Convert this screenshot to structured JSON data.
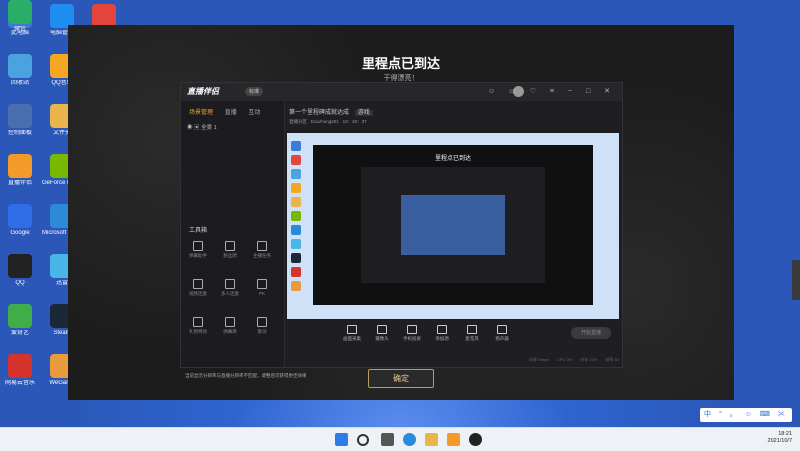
{
  "desktop": {
    "icons": [
      {
        "label": "此电脑",
        "color": "#3a7bd5"
      },
      {
        "label": "电脑管家",
        "color": "#1f8ef1"
      },
      {
        "label": "WPS Office",
        "color": "#e2453c"
      },
      {
        "label": "回收站",
        "color": "#4aa3df"
      },
      {
        "label": "QQ音乐",
        "color": "#f5a623"
      },
      {
        "label": "控制面板",
        "color": "#4a6fb0"
      },
      {
        "label": "文件夹",
        "color": "#e9b44c"
      },
      {
        "label": "直播伴侣",
        "color": "#f39a2b"
      },
      {
        "label": "GeForce Experience",
        "color": "#76b900"
      },
      {
        "label": "Google",
        "color": "#2f6ee8"
      },
      {
        "label": "Microsoft Edge",
        "color": "#2b8bd8"
      },
      {
        "label": "QQ",
        "color": "#222222"
      },
      {
        "label": "迅雷",
        "color": "#49b6e8"
      },
      {
        "label": "爱奇艺",
        "color": "#3fae49"
      },
      {
        "label": "Steam",
        "color": "#1b2838"
      },
      {
        "label": "网易云音乐",
        "color": "#d6322e"
      },
      {
        "label": "WeGame",
        "color": "#e89a3c"
      },
      {
        "label": "微信",
        "color": "#2aae67"
      }
    ]
  },
  "overlay": {
    "title": "里程点已到达",
    "subtitle": "干得漂亮！",
    "ok_button": "确定"
  },
  "app": {
    "name": "直播伴侣",
    "badge": "标准",
    "left_tabs": [
      "场景管理",
      "直播",
      "互动"
    ],
    "scene_item": "全景 1",
    "tools_label": "工具箱",
    "tools": [
      "弹幕助手",
      "粉丝牌",
      "主播任务",
      "视频连麦",
      "多人连麦",
      "PK",
      "礼物特效",
      "弹幕库",
      "歌词"
    ],
    "stream_title": "第一个里程碑成就达成",
    "stream_tag": "游戏",
    "stream_meta": [
      "直播分区",
      "Douzhong201",
      "10：40：37"
    ],
    "preview_title": "里程点已到达",
    "bottom_tools": [
      "画面采集",
      "摄像头",
      "手机投屏",
      "添加源",
      "麦克风",
      "扬声器"
    ],
    "live_button": "开始直播",
    "tip": "当前显示分辨率与直播分辨率不匹配，调整后可获得更佳效果",
    "stats": "码率 0kbps　　CPU 3%　　内存 23%　　帧率 60"
  },
  "taskbar": {
    "time": "18:21",
    "date": "2021/10/7",
    "ime": "中 ° 。 ☺ ⌨ ✂"
  }
}
